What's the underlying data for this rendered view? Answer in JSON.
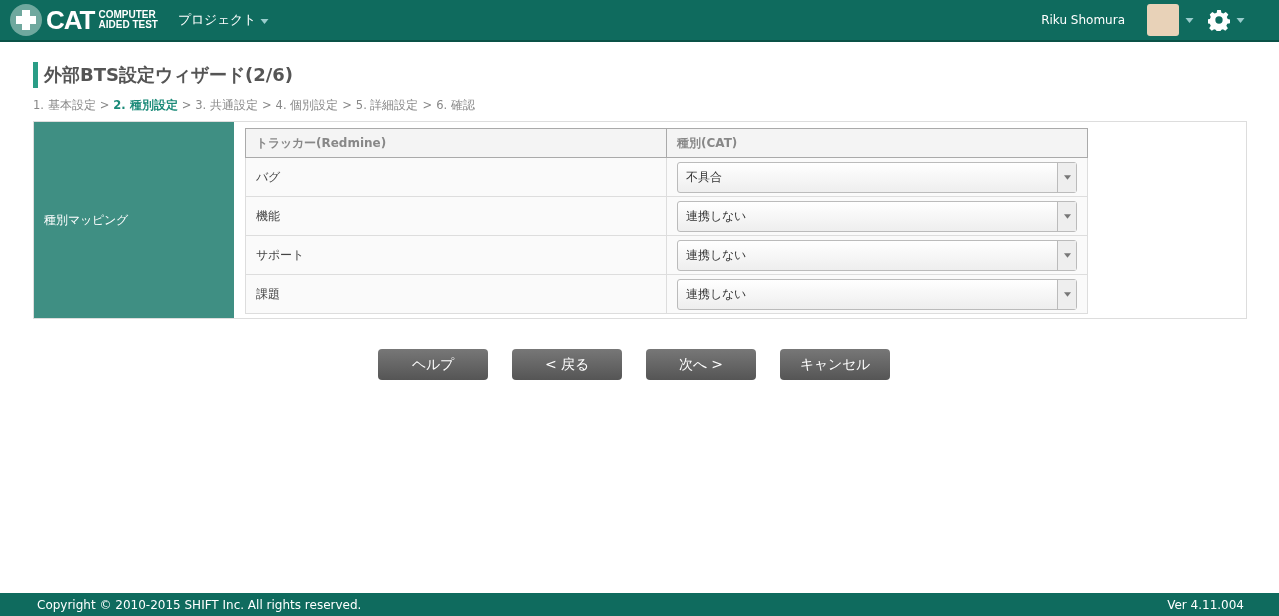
{
  "header": {
    "logo_main": "CAT",
    "logo_sub": [
      "COMPUTER",
      "AIDED TEST"
    ],
    "menu": "プロジェクト",
    "user_name": "Riku Shomura"
  },
  "page_title": "外部BTS設定ウィザード(2/6)",
  "steps_separator": ">",
  "steps": [
    {
      "label": "1. 基本設定",
      "selected": false
    },
    {
      "label": "2. 種別設定",
      "selected": true
    },
    {
      "label": "3. 共通設定",
      "selected": false
    },
    {
      "label": "4. 個別設定",
      "selected": false
    },
    {
      "label": "5. 詳細設定",
      "selected": false
    },
    {
      "label": "6. 確認",
      "selected": false
    }
  ],
  "mapping": {
    "label": "種別マッピング",
    "columns": [
      "トラッカー(Redmine)",
      "種別(CAT)"
    ],
    "rows": [
      {
        "tracker": "バグ",
        "type": "不具合"
      },
      {
        "tracker": "機能",
        "type": "連携しない"
      },
      {
        "tracker": "サポート",
        "type": "連携しない"
      },
      {
        "tracker": "課題",
        "type": "連携しない"
      }
    ]
  },
  "buttons": [
    "ヘルプ",
    "< 戻る",
    "次へ >",
    "キャンセル"
  ],
  "footer": {
    "copyright": "Copyright © 2010-2015 SHIFT Inc. All rights reserved.",
    "version": "Ver 4.11.004"
  }
}
